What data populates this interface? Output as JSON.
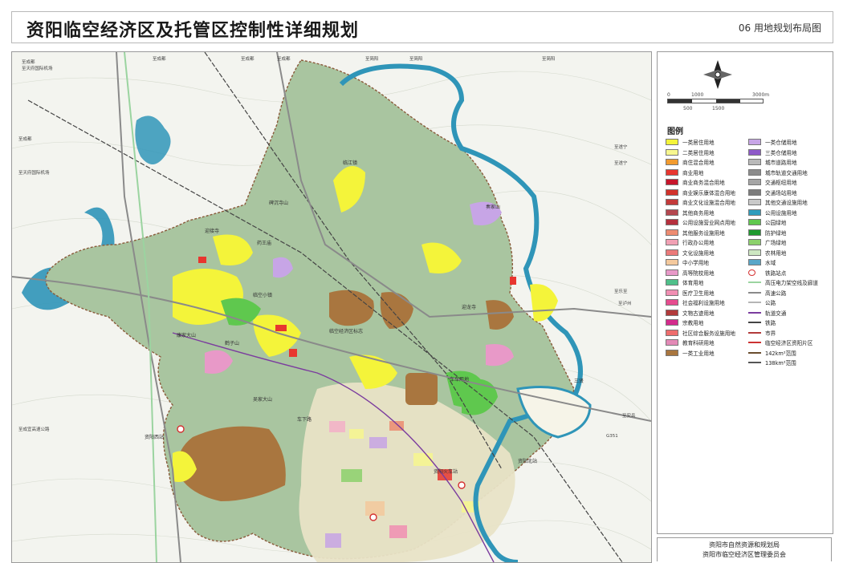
{
  "header": {
    "title": "资阳临空经济区及托管区控制性详细规划",
    "sheet": "06 用地规划布局图"
  },
  "scale": {
    "ticks": [
      "0",
      "1000",
      "3000m",
      "500",
      "1500"
    ]
  },
  "legend": {
    "heading": "图例",
    "left": [
      {
        "label": "一类居住用地",
        "color": "#f4f43a",
        "kind": "area"
      },
      {
        "label": "二类居住用地",
        "color": "#f7f78f",
        "kind": "area"
      },
      {
        "label": "商住混合用地",
        "color": "#f29b2f",
        "kind": "area"
      },
      {
        "label": "商业用地",
        "color": "#e8362f",
        "kind": "area"
      },
      {
        "label": "商业商务混合用地",
        "color": "#c7162b",
        "kind": "area"
      },
      {
        "label": "商业娱乐康体混合用地",
        "color": "#d2322b",
        "kind": "area"
      },
      {
        "label": "商业文化设施混合用地",
        "color": "#c33a3a",
        "kind": "area"
      },
      {
        "label": "其他商务用地",
        "color": "#b4474f",
        "kind": "area"
      },
      {
        "label": "公用设施营业网点用地",
        "color": "#b5303d",
        "kind": "area"
      },
      {
        "label": "其他服务设施用地",
        "color": "#ed8c71",
        "kind": "area"
      },
      {
        "label": "行政办公用地",
        "color": "#f1a1b4",
        "kind": "area"
      },
      {
        "label": "文化设施用地",
        "color": "#eb7a7a",
        "kind": "area"
      },
      {
        "label": "中小学用地",
        "color": "#f4c99d",
        "kind": "area"
      },
      {
        "label": "高等院校用地",
        "color": "#e899c8",
        "kind": "area"
      },
      {
        "label": "体育用地",
        "color": "#4fc08a",
        "kind": "area"
      },
      {
        "label": "医疗卫生用地",
        "color": "#f18fb3",
        "kind": "area"
      },
      {
        "label": "社会福利设施用地",
        "color": "#e64c8f",
        "kind": "area"
      },
      {
        "label": "文物古迹用地",
        "color": "#b23b3b",
        "kind": "area"
      },
      {
        "label": "宗教用地",
        "color": "#d42b8c",
        "kind": "area"
      },
      {
        "label": "社区综合服务设施用地",
        "color": "#ee6d6d",
        "kind": "area"
      },
      {
        "label": "教育科研用地",
        "color": "#e38ab7",
        "kind": "area"
      },
      {
        "label": "一类工业用地",
        "color": "#a9763f",
        "kind": "area"
      }
    ],
    "right": [
      {
        "label": "一类仓储用地",
        "color": "#c7a5e6",
        "kind": "area"
      },
      {
        "label": "三类仓储用地",
        "color": "#8e59c9",
        "kind": "area"
      },
      {
        "label": "城市道路用地",
        "color": "#b9b9b9",
        "kind": "area"
      },
      {
        "label": "城市轨道交通用地",
        "color": "#8c8c8c",
        "kind": "area"
      },
      {
        "label": "交通枢纽用地",
        "color": "#a6a6a6",
        "kind": "area"
      },
      {
        "label": "交通场站用地",
        "color": "#7c7c7c",
        "kind": "area"
      },
      {
        "label": "其他交通设施用地",
        "color": "#c9c9c9",
        "kind": "area"
      },
      {
        "label": "公用设施用地",
        "color": "#2e9dbd",
        "kind": "area"
      },
      {
        "label": "公园绿地",
        "color": "#5fc84e",
        "kind": "area"
      },
      {
        "label": "防护绿地",
        "color": "#1f9a2f",
        "kind": "area"
      },
      {
        "label": "广场绿地",
        "color": "#8cd16c",
        "kind": "area"
      },
      {
        "label": "农林用地",
        "color": "#cde7c1",
        "kind": "area"
      },
      {
        "label": "水域",
        "color": "#58a7c9",
        "kind": "area"
      },
      {
        "label": "铁路站点",
        "color": "#d43030",
        "kind": "symbol"
      },
      {
        "label": "高压电力架空线及廊道",
        "color": "#9bd4a0",
        "kind": "line"
      },
      {
        "label": "高速公路",
        "color": "#8a8a8a",
        "kind": "line"
      },
      {
        "label": "公路",
        "color": "#b5b5b5",
        "kind": "line"
      },
      {
        "label": "轨道交通",
        "color": "#7b3c9e",
        "kind": "line"
      },
      {
        "label": "铁路",
        "color": "#444444",
        "kind": "line"
      },
      {
        "label": "市界",
        "color": "#b23b3b",
        "kind": "line"
      },
      {
        "label": "临空经济区资阳片区",
        "color": "#cc3333",
        "kind": "line"
      },
      {
        "label": "142km²范围",
        "color": "#6a4d2e",
        "kind": "line"
      },
      {
        "label": "138km²范围",
        "color": "#555555",
        "kind": "line"
      }
    ]
  },
  "agency": {
    "line1": "资阳市自然资源和规划局",
    "line2": "资阳市临空经济区管理委员会"
  },
  "map": {
    "edge_labels": {
      "top_left_1": "至成都",
      "top_left_2": "至天府国际机场",
      "top_1": "至成都",
      "top_2": "至成都",
      "top_3": "至成都",
      "top_4": "至简阳",
      "top_5": "至简阳",
      "top_6": "至简阳",
      "left_1": "至成都",
      "left_2": "至天府国际机场",
      "left_3": "至成宜高速公路",
      "right_1": "至遂宁",
      "right_2": "至遂宁",
      "right_3": "至乐至",
      "right_4": "至泸州",
      "right_5": "至安岳",
      "right_6": "G351"
    },
    "place_labels": {
      "p1": "临江镇",
      "p2": "碑沉寺山",
      "p3": "迎接寺",
      "p4": "药王庙",
      "p5": "奏家山",
      "p6": "车车用地",
      "p7": "临空小镇",
      "p8": "康家大山",
      "p9": "鹤子山",
      "p10": "吴家大山",
      "p11": "车下路",
      "p12": "资阳西站",
      "p13": "迎龙寺",
      "p14": "资阳北站",
      "p15": "三贤",
      "p16": "资阳火车站",
      "p17": "临空经济区标志"
    },
    "colors": {
      "water": "#2f95b8",
      "base": "#a9c5a0",
      "hill": "#dfe8d8"
    }
  }
}
